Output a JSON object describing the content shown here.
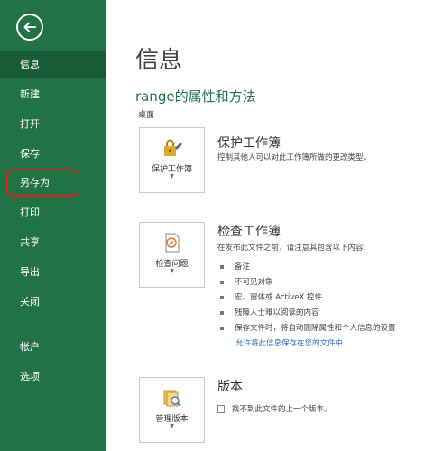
{
  "sidebar": {
    "items": [
      {
        "label": "信息",
        "active": true
      },
      {
        "label": "新建"
      },
      {
        "label": "打开"
      },
      {
        "label": "保存"
      },
      {
        "label": "另存为",
        "highlighted": true
      },
      {
        "label": "打印"
      },
      {
        "label": "共享"
      },
      {
        "label": "导出"
      },
      {
        "label": "关闭"
      }
    ],
    "bottom_items": [
      {
        "label": "帐户"
      },
      {
        "label": "选项"
      }
    ]
  },
  "main": {
    "title": "信息",
    "document_title": "range的属性和方法",
    "document_location": "桌面",
    "protect": {
      "button_label": "保护工作簿",
      "title": "保护工作簿",
      "description": "控制其他人可以对此工作簿所做的更改类型。"
    },
    "inspect": {
      "button_label": "检查问题",
      "title": "检查工作簿",
      "description": "在发布此文件之前，请注意其包含以下内容:",
      "bullets": [
        "备注",
        "不可见对象",
        "宏、窗体或 ActiveX 控件",
        "残障人士难以阅读的内容",
        "保存文件时，将自动删除属性和个人信息的设置"
      ],
      "link": "允许将此信息保存在您的文件中"
    },
    "versions": {
      "button_label": "管理版本",
      "title": "版本",
      "description": "找不到此文件的上一个版本。"
    }
  },
  "colors": {
    "sidebar": "#217346",
    "active": "#185c37",
    "highlight": "#e02020",
    "link": "#2e6db4"
  }
}
